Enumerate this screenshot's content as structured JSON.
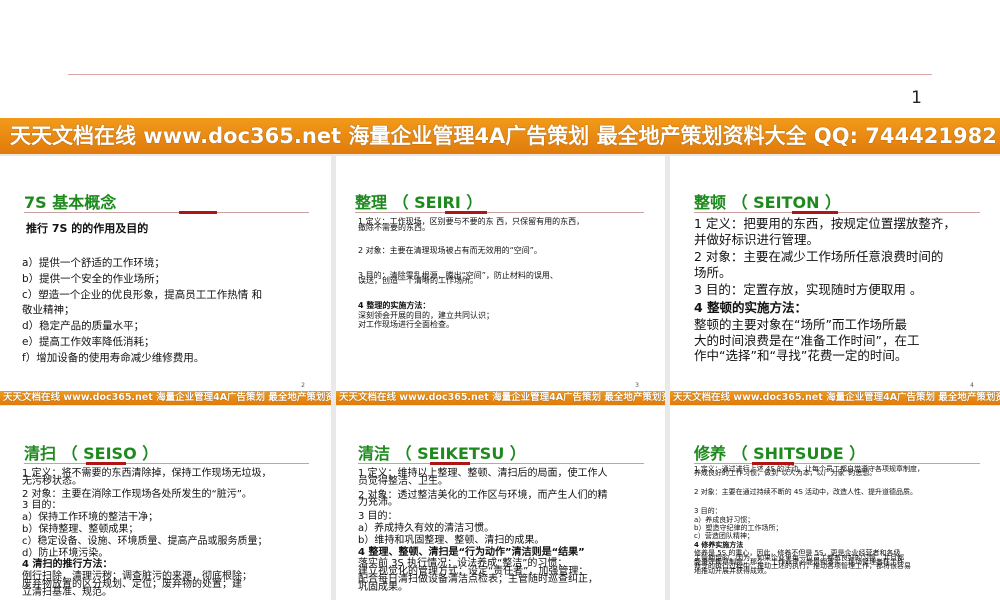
{
  "page_number": "1",
  "banner": {
    "big": "天天文档在线  www.doc365.net  海量企业管理4A广告策划 最全地产策划资料大全  QQ: 744421982",
    "small": "天天文档在线  www.doc365.net  海量企业管理4A广告策划 最全地产策划资料大全  QQ: 744421982"
  },
  "slides": [
    {
      "title": "7S 基本概念",
      "subtitle": "推行 7S 的的作用及目的",
      "lines": [
        "a）提供一个舒适的工作环境；",
        "b）提供一个安全的作业场所；",
        "c）塑造一个企业的优良形象，提高员工工作热情    和",
        "    敬业精神；",
        "d）稳定产品的质量水平；",
        "e）提高工作效率降低消耗；",
        "f）增加设备的使用寿命减少维修费用。"
      ],
      "slide_number": "2"
    },
    {
      "title": "整理 （ SEIRI ）",
      "lines": [
        "1    定义：工作现场，区别要与不要的东 西，只保留有用的东西，",
        "         撤除不需要的东西。",
        "2    对象：主要在清理现场被占有而无效用的“空间”。",
        "3    目的：清除零乱根源，腾出“空间”，防止材料的误用、",
        "         误送，创造一个清晰的工作场所。",
        "4    整理的实施方法：",
        "               深刻领会开展的目的，建立共同认识；",
        "               对工作现场进行全面检查。"
      ],
      "slide_number": "3"
    },
    {
      "title": "整顿 （ SEITON ）",
      "lines": [
        "1   定义：把要用的东西，按规定位置摆放整齐，",
        "     并做好标识进行管理。",
        "2   对象：主要在减少工作场所任意浪费时间的",
        "     场所。",
        "3   目的：定置存放，实现随时方便取用 。",
        "4   整顿的实施方法：",
        "     整顿的主要对象在“场所”而工作场所最",
        "大的时间浪费是在“准备工作时间”，在工",
        "作中“选择”和“寻找”花费一定的时间。"
      ],
      "slide_number": "4"
    },
    {
      "title": "清扫 （ SEISO ）",
      "lines": [
        "1    定义：将不需要的东西清除掉，保持工作现场无垃圾，",
        "       无污秽状态。",
        "2    对象：主要在消除工作现场各处所发生的“脏污”。",
        "3    目的：",
        "  a）保持工作环境的整洁干净；",
        "  b）保持整理、整顿成果；",
        "  c）稳定设备、设施、环境质量、提高产品或服务质量；",
        "  d）防止环境污染。",
        "4    清扫的推行方法：",
        "        例行扫除，清理污秽；调查脏污的来源，彻底根除；",
        "    废弃物放置的区分规划、定位；废弃物的处置；建",
        "    立清扫基准、规范。"
      ]
    },
    {
      "title": "清洁 （ SEIKETSU ）",
      "lines": [
        "1    定义：维持以上整理、整顿、清扫后的局面，使工作人",
        "       员觉得整洁、卫生。",
        "2    对象：透过整洁美化的工作区与环境，而产生人们的精",
        "       力充沛。",
        "3    目的：",
        "  a）养成持久有效的清洁习惯。",
        "  b）维持和巩固整理、整顿、清扫的成果。",
        "4    整理、整顿、清扫是“行为动作”清洁则是“结果”",
        "        落实前 3S 执行情况；设法养成“整洁”的习惯；",
        "    建立视觉化的管理方式；设定“责任者”，加强管理；",
        "    配合每日清扫做设备清洁点检表；主管随时巡查纠正，",
        "    巩固成果。"
      ]
    },
    {
      "title": "修养 （ SHITSUDE ）",
      "lines": [
        "1    定义：通过进行上述 4S 的活动，让每个员工都自觉遵守各项规章制度，",
        "       养成良好的工作习惯，做到“以人为本，以厂为家”的思想。",
        "2    对象：主要在通过持续不断的 4S 活动中，改造人性、提升道德品质。",
        "3    目的：",
        "  a）养成良好习惯；",
        "  b）塑造守纪律的工作场所；",
        "  c）营造团队精神；",
        "4    修养实施方法",
        "        修养是 5S 的重心，因此，修养不但是 5S，更是企业经营者和各级",
        "    主管期望的，因为，如果企业里每一位员工都有良好的习惯，并且都",
        "    能遵守规章制度，那么，工作命令必能贯彻落实，现场管理者在工作",
        "    命令的执行过程中，推动上述的执行，推动各项管理工作，都将很容易",
        "    地推动开展并获得成效。"
      ]
    }
  ]
}
